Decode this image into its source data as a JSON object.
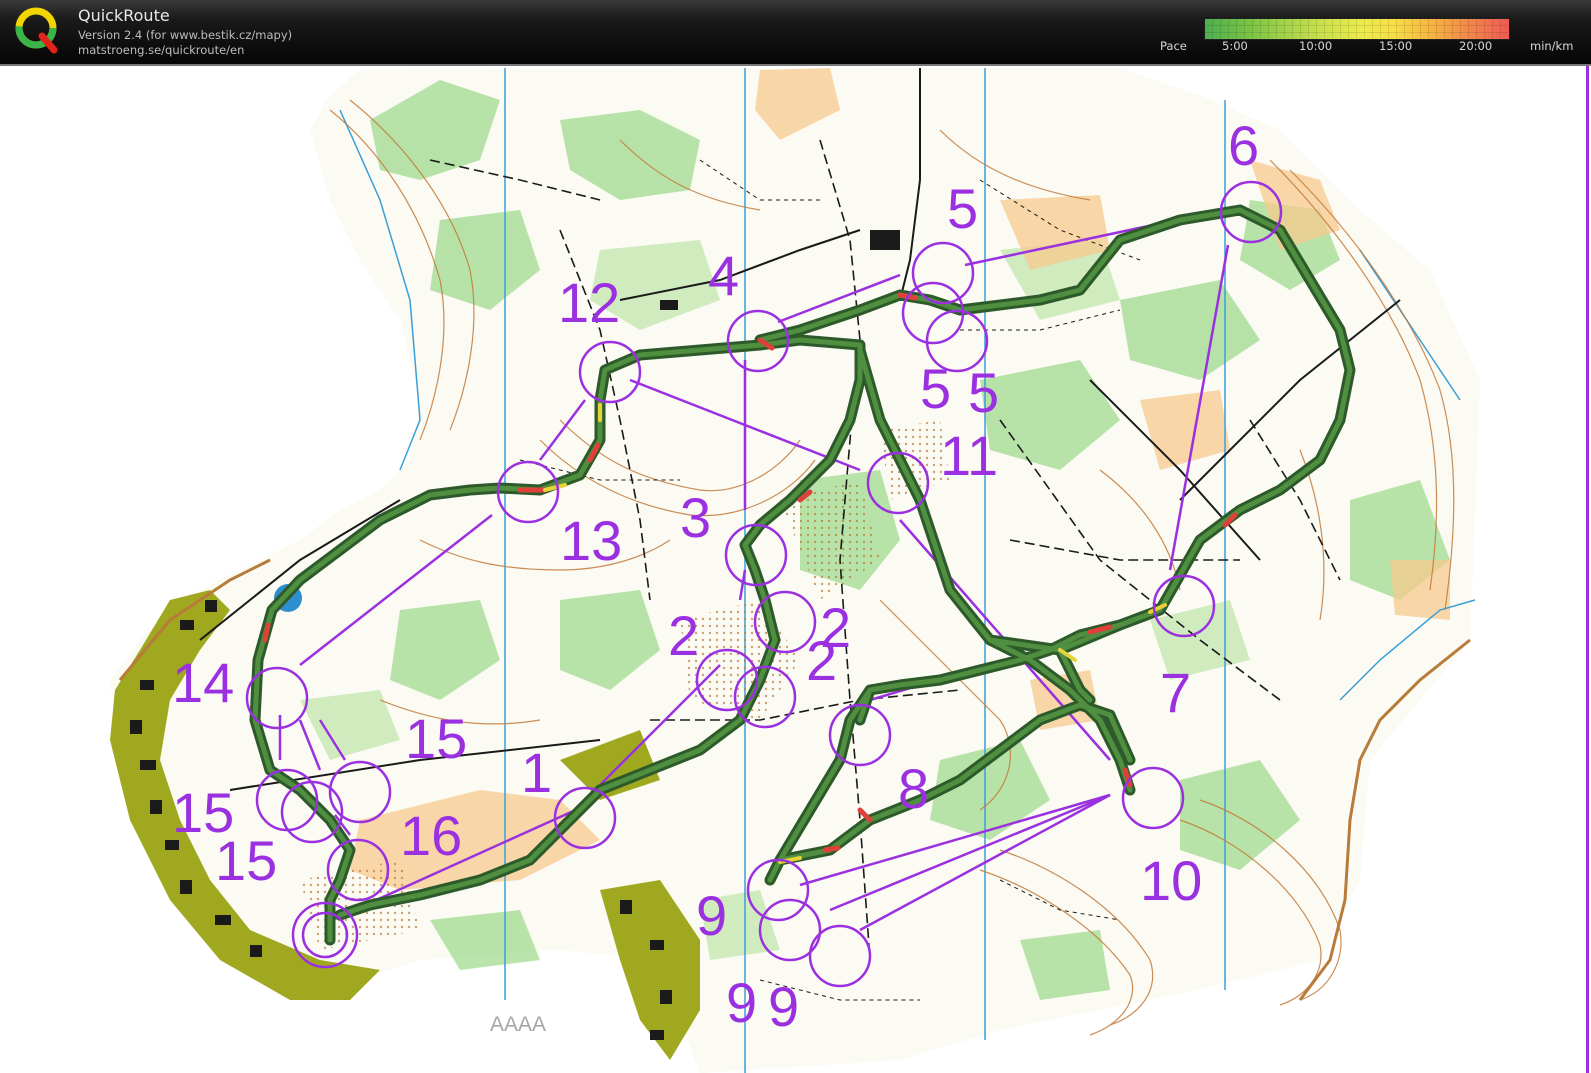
{
  "app": {
    "title": "QuickRoute",
    "version": "Version 2.4  (for www.bestik.cz/mapy)",
    "url": "matstroeng.se/quickroute/en",
    "logo_letter": "Q"
  },
  "pace_legend": {
    "label": "Pace",
    "ticks": [
      "5:00",
      "10:00",
      "15:00",
      "20:00"
    ],
    "unit": "min/km"
  },
  "map": {
    "watermark": "AAAA",
    "control_numbers": [
      "1",
      "2",
      "2",
      "2",
      "3",
      "4",
      "5",
      "5",
      "5",
      "6",
      "7",
      "8",
      "9",
      "9",
      "9",
      "10",
      "11",
      "12",
      "13",
      "14",
      "15",
      "15",
      "15",
      "16"
    ]
  },
  "colors": {
    "course": "#9b30e0",
    "route_outer": "#2d5a2a",
    "route_inner": "#3f7a35",
    "route_hot": "#e0403a",
    "forest_green": "#7fd06a",
    "open_yellow": "#f7c98e",
    "contour": "#c27a3a",
    "settlement": "#a0a820",
    "water": "#3a9fd8"
  }
}
